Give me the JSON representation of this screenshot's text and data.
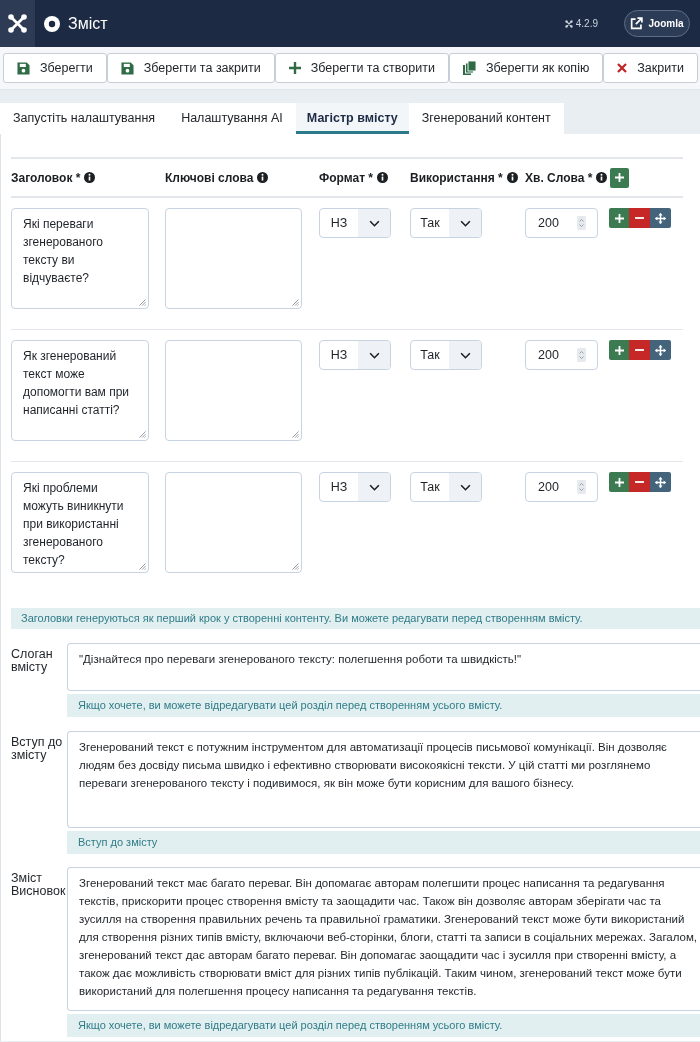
{
  "header": {
    "title": "Зміст",
    "version": "4.2.9",
    "site_link": "Joomla"
  },
  "toolbar": [
    {
      "label": "Зберегти",
      "kind": "save"
    },
    {
      "label": "Зберегти та закрити",
      "kind": "save"
    },
    {
      "label": "Зберегти та створити",
      "kind": "new"
    },
    {
      "label": "Зберегти як копію",
      "kind": "copy"
    },
    {
      "label": "Закрити",
      "kind": "close"
    }
  ],
  "tabs": [
    {
      "label": "Запустіть налаштування",
      "selected": false
    },
    {
      "label": "Налаштування AI",
      "selected": false
    },
    {
      "label": "Магістр вмісту",
      "selected": true
    },
    {
      "label": "Згенерований контент",
      "selected": false
    }
  ],
  "table": {
    "columns": [
      "Заголовок *",
      "Ключові слова",
      "Формат *",
      "Використання *",
      "Хв. Слова *"
    ],
    "rows": [
      {
        "title": "Які переваги згенерованого тексту ви відчуваєте?",
        "format": "НЗ",
        "usage": "Так",
        "min_words": "200"
      },
      {
        "title": "Як згенерований текст може допомогти вам при написанні статті?",
        "format": "НЗ",
        "usage": "Так",
        "min_words": "200"
      },
      {
        "title": "Які проблеми можуть виникнути при використанні згенерованого тексту?",
        "format": "НЗ",
        "usage": "Так",
        "min_words": "200"
      }
    ]
  },
  "notice": "Заголовки генеруються як перший крок у створенні контенту. Ви можете редагувати перед створенням вмісту.",
  "sections": [
    {
      "label": "Слоган вмісту",
      "value": "\"Дізнайтеся про переваги згенерованого тексту: полегшення роботи та швидкість!\"",
      "hint": "Якщо хочете, ви можете відредагувати цей розділ перед створенням усього вмісту."
    },
    {
      "label": "Вступ до змісту",
      "value": "Згенерований текст є потужним інструментом для автоматизації процесів письмової комунікації. Він дозволяє людям без досвіду письма швидко і ефективно створювати високоякісні тексти. У цій статті ми розглянемо переваги згенерованого тексту і подивимося, як він може бути корисним для вашого бізнесу.",
      "hint": "Вступ до змісту"
    },
    {
      "label": "Зміст Висновок",
      "value": "Згенерований текст має багато переваг. Він допомагає авторам полегшити процес написання та редагування текстів, прискорити процес створення вмісту та заощадити час. Також він дозволяє авторам зберігати час та зусилля на створення правильних речень та правильної граматики. Згенерований текст може бути використаний для створення різних типів вмісту, включаючи веб-сторінки, блоги, статті та записи в соціальних мережах. Загалом, згенерований текст дає авторам багато переваг. Він допомагає заощадити час і зусилля при створенні вмісту, а також дає можливість створювати вміст для різних типів публікацій. Таким чином, згенерований текст може бути використаний для полегшення процесу написання та редагування текстів.",
      "hint": "Якщо хочете, ви можете відредагувати цей розділ перед створенням усього вмісту."
    }
  ]
}
